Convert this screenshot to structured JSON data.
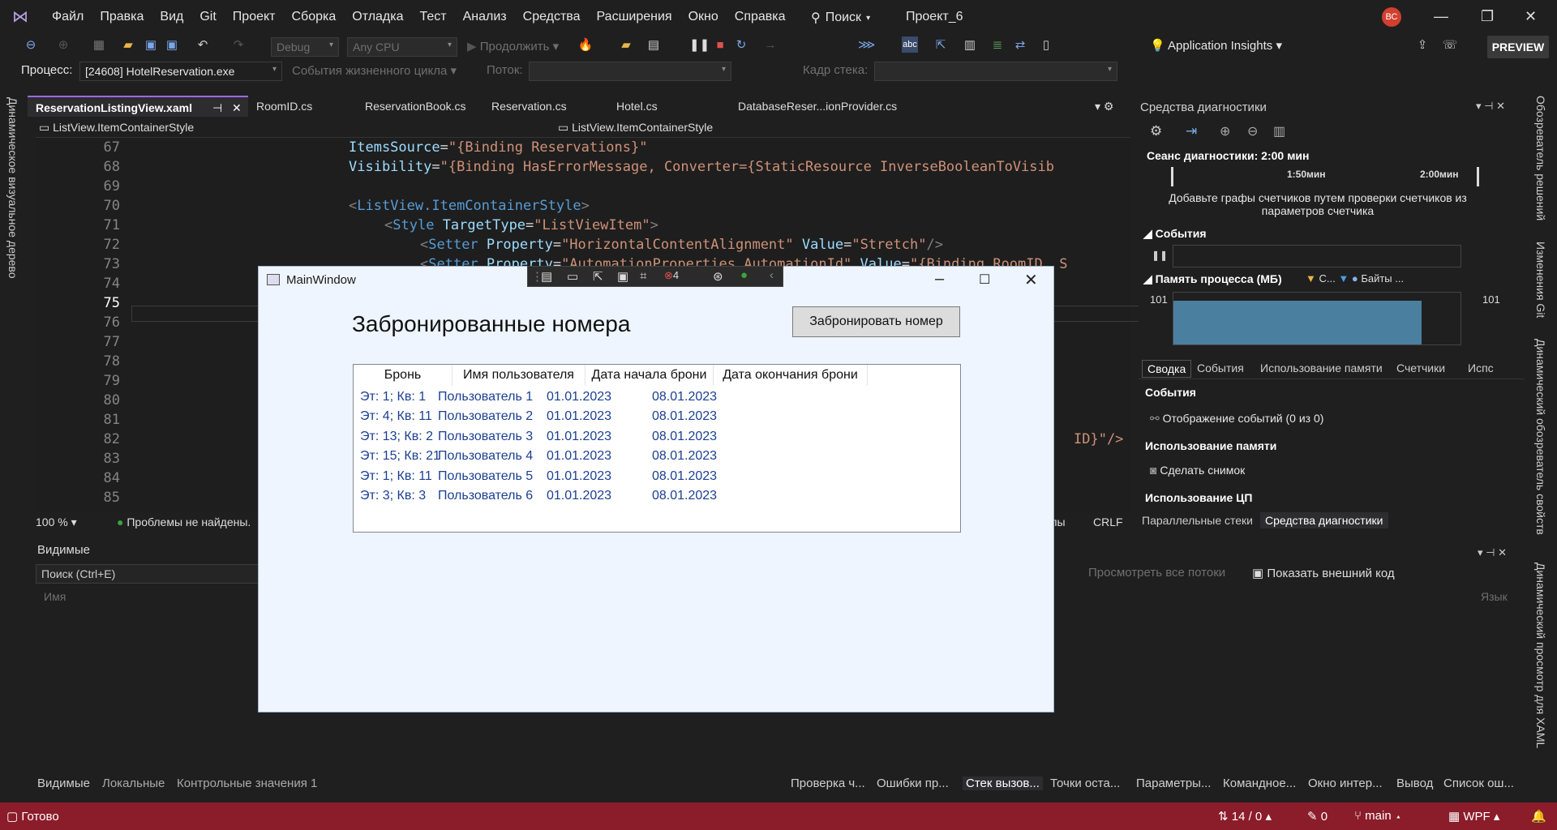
{
  "menu": {
    "items": [
      "Файл",
      "Правка",
      "Вид",
      "Git",
      "Проект",
      "Сборка",
      "Отладка",
      "Тест",
      "Анализ",
      "Средства",
      "Расширения",
      "Окно",
      "Справка"
    ],
    "search_label": "Поиск",
    "project": "Проект_6",
    "avatar_initials": "ВС"
  },
  "toolbar": {
    "config": "Debug",
    "platform": "Any CPU",
    "continue_label": "Продолжить",
    "insights": "Application Insights",
    "preview": "PREVIEW"
  },
  "debugbar": {
    "process_label": "Процесс:",
    "process_value": "[24608] HotelReservation.exe",
    "lifecycle": "События жизненного цикла",
    "thread_label": "Поток:",
    "stack_label": "Кадр стека:"
  },
  "left_strip": "Динамическое визуальное дерево",
  "right_strip": [
    "Обозреватель решений",
    "Изменения Git",
    "Динамический обозреватель свойств",
    "Динамический просмотр для XAML"
  ],
  "editor": {
    "tabs": [
      "ReservationListingView.xaml",
      "RoomID.cs",
      "ReservationBook.cs",
      "Reservation.cs",
      "Hotel.cs",
      "DatabaseReser...ionProvider.cs"
    ],
    "nav_left": "ListView.ItemContainerStyle",
    "nav_right": "ListView.ItemContainerStyle",
    "line_numbers": [
      "67",
      "68",
      "69",
      "70",
      "71",
      "72",
      "73",
      "74",
      "75",
      "76",
      "77",
      "78",
      "79",
      "80",
      "81",
      "82",
      "83",
      "84",
      "85"
    ],
    "zoom": "100 %",
    "problems": "Проблемы не найдены.",
    "line_ending": "CRLF",
    "encoding_fragment": "елы",
    "partial_code": "ID}\"/>"
  },
  "locals_panel": {
    "title": "Видимые",
    "search_placeholder": "Поиск (Ctrl+E)",
    "column_name": "Имя",
    "bottom_tabs": [
      "Видимые",
      "Локальные",
      "Контрольные значения 1"
    ]
  },
  "callstack_panel": {
    "view_threads": "Просмотреть все потоки",
    "show_external": "Показать внешний код",
    "column_lang": "Язык",
    "bottom_tabs": [
      "Проверка ч...",
      "Ошибки пр...",
      "Стек вызов...",
      "Точки оста...",
      "Параметры...",
      "Командное...",
      "Окно интер...",
      "Вывод",
      "Список ош..."
    ]
  },
  "diagnostics": {
    "title": "Средства диагностики",
    "session": "Сеанс диагностики: 2:00 мин",
    "tick1": "1:50мин",
    "tick2": "2:00мин",
    "add_counters": "Добавьте графы счетчиков путем проверки счетчиков из параметров счетчика",
    "events_section": "События",
    "memory_section": "Память процесса (МБ)",
    "legend_c": "С...",
    "legend_bytes": "Байты ...",
    "mem_max_left": "101",
    "mem_max_right": "101",
    "tabs": [
      "Сводка",
      "События",
      "Использование памяти",
      "Счетчики",
      "Испс"
    ],
    "summary_events": "События",
    "show_events": "Отображение событий (0 из 0)",
    "memory_usage": "Использование памяти",
    "take_snapshot": "Сделать снимок",
    "cpu_usage": "Использование ЦП",
    "bottom_tabs": [
      "Параллельные стеки",
      "Средства диагностики"
    ]
  },
  "xaml_toolbar": {
    "errors": "4"
  },
  "main_window": {
    "title": "MainWindow",
    "heading": "Забронированные номера",
    "book_button": "Забронировать номер",
    "columns": [
      "Бронь",
      "Имя пользователя",
      "Дата начала брони",
      "Дата окончания брони"
    ],
    "rows": [
      [
        "Эт: 1; Кв: 1",
        "Пользователь 1",
        "01.01.2023",
        "08.01.2023"
      ],
      [
        "Эт: 4; Кв: 11",
        "Пользователь 2",
        "01.01.2023",
        "08.01.2023"
      ],
      [
        "Эт: 13; Кв: 2",
        "Пользователь 3",
        "01.01.2023",
        "08.01.2023"
      ],
      [
        "Эт: 15; Кв: 21",
        "Пользователь 4",
        "01.01.2023",
        "08.01.2023"
      ],
      [
        "Эт: 1; Кв: 11",
        "Пользователь 5",
        "01.01.2023",
        "08.01.2023"
      ],
      [
        "Эт: 3; Кв: 3",
        "Пользователь 6",
        "01.01.2023",
        "08.01.2023"
      ]
    ]
  },
  "statusbar": {
    "ready": "Готово",
    "position": "14 / 0",
    "pencil_count": "0",
    "branch": "main",
    "project_type": "WPF"
  },
  "colors": {
    "accent": "#9c6ade",
    "status": "#8b1c2a",
    "window_bg": "#eef5fe",
    "link_text": "#1b3f92"
  }
}
